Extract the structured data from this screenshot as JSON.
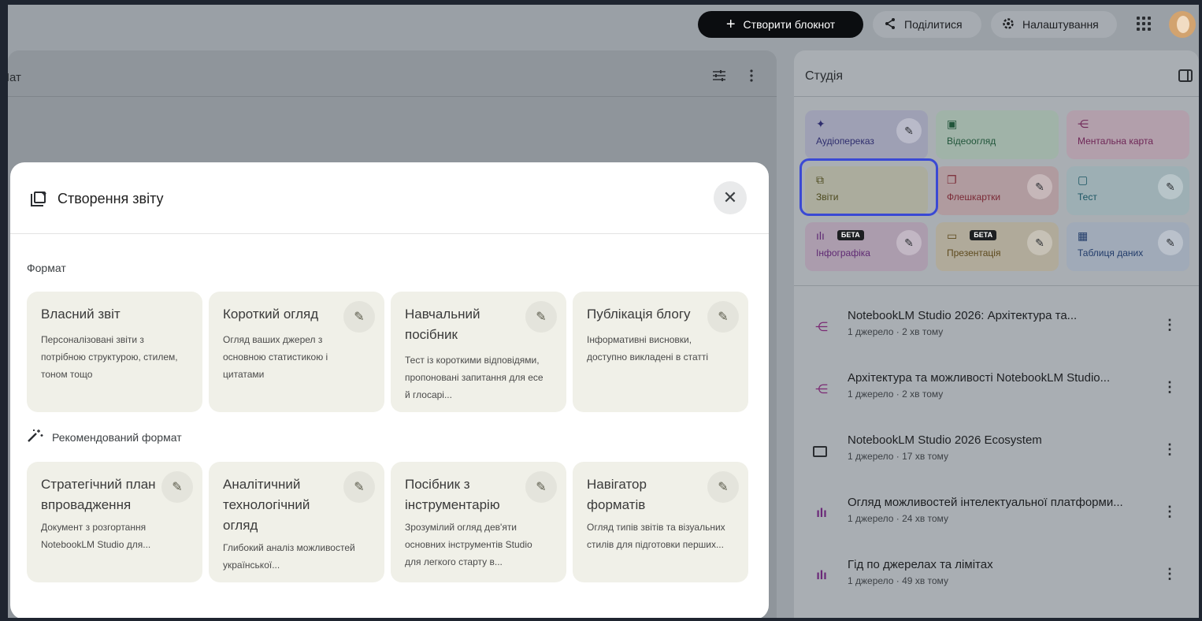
{
  "topbar": {
    "create_label": "Створити блокнот",
    "share_label": "Поділитися",
    "settings_label": "Налаштування"
  },
  "chat": {
    "title": "Чат"
  },
  "studio": {
    "title": "Студія",
    "tiles": [
      {
        "label": "Аудіопереказ",
        "icon": "audio-sparkle-icon",
        "editable": true,
        "beta": false
      },
      {
        "label": "Відеоогляд",
        "icon": "video-icon",
        "editable": false,
        "beta": false
      },
      {
        "label": "Ментальна карта",
        "icon": "mindmap-icon",
        "editable": false,
        "beta": false
      },
      {
        "label": "Звіти",
        "icon": "reports-icon",
        "editable": false,
        "beta": false
      },
      {
        "label": "Флешкартки",
        "icon": "flashcards-icon",
        "editable": true,
        "beta": false
      },
      {
        "label": "Тест",
        "icon": "quiz-icon",
        "editable": true,
        "beta": false
      },
      {
        "label": "Інфографіка",
        "icon": "infographic-icon",
        "editable": true,
        "beta": true
      },
      {
        "label": "Презентація",
        "icon": "presentation-icon",
        "editable": true,
        "beta": true
      },
      {
        "label": "Таблиця даних",
        "icon": "table-icon",
        "editable": true,
        "beta": false
      }
    ],
    "beta_label": "БЕТА",
    "notes": [
      {
        "title": "NotebookLM Studio 2026: Архітектура та...",
        "meta": "1 джерело · 2 хв тому",
        "icon": "mindmap-icon"
      },
      {
        "title": "Архітектура та можливості NotebookLM Studio...",
        "meta": "1 джерело · 2 хв тому",
        "icon": "mindmap-icon"
      },
      {
        "title": "NotebookLM Studio 2026 Ecosystem",
        "meta": "1 джерело · 17 хв тому",
        "icon": "presentation-icon"
      },
      {
        "title": "Огляд можливостей інтелектуальної платформи...",
        "meta": "1 джерело · 24 хв тому",
        "icon": "infographic-icon"
      },
      {
        "title": "Гід по джерелах та лімітах",
        "meta": "1 джерело · 49 хв тому",
        "icon": "infographic-icon"
      }
    ]
  },
  "modal": {
    "title": "Створення звіту",
    "format_label": "Формат",
    "recommended_label": "Рекомендований формат",
    "formats": [
      {
        "title": "Власний звіт",
        "desc": "Персоналізовані звіти з потрібною структурою, стилем, тоном тощо",
        "editable": false
      },
      {
        "title": "Короткий огляд",
        "desc": "Огляд ваших джерел з основною статистикою і цитатами",
        "editable": true
      },
      {
        "title": "Навчальний посібник",
        "desc": "Тест із короткими відповідями, пропоновані запитання для есе й глосарі...",
        "editable": true
      },
      {
        "title": "Публікація блогу",
        "desc": "Інформативні висновки, доступно викладені в статті",
        "editable": true
      }
    ],
    "recommended": [
      {
        "title": "Стратегічний план впровадження",
        "desc": "Документ з розгортання NotebookLM Studio для...",
        "editable": true
      },
      {
        "title": "Аналітичний технологічний огляд",
        "desc": "Глибокий аналіз можливостей української...",
        "editable": true
      },
      {
        "title": "Посібник з інструментарію",
        "desc": "Зрозумілий огляд дев'яти основних інструментів Studio для легкого старту в...",
        "editable": true
      },
      {
        "title": "Навігатор форматів",
        "desc": "Огляд типів звітів та візуальних стилів для підготовки перших...",
        "editable": true
      }
    ]
  }
}
